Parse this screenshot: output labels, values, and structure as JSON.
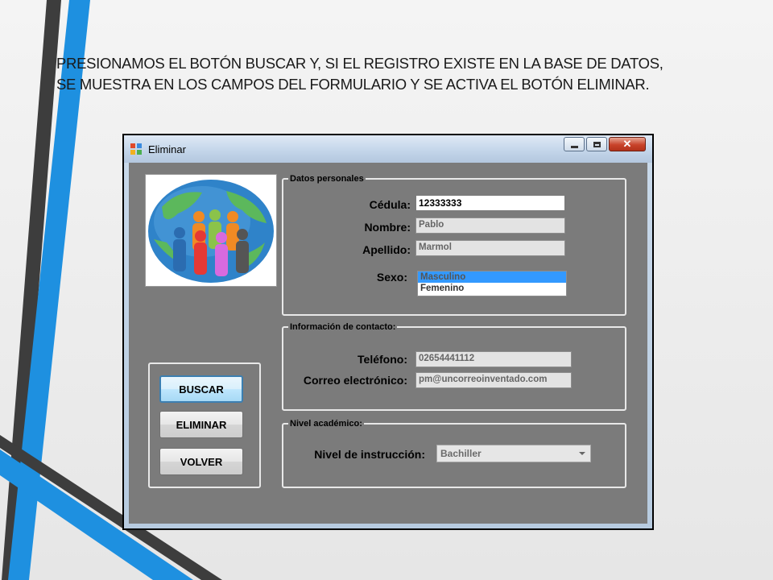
{
  "slide": {
    "line1": "PRESIONAMOS EL BOTÓN BUSCAR Y, SI EL REGISTRO EXISTE EN LA BASE DE DATOS,",
    "line2": "SE MUESTRA EN LOS CAMPOS DEL FORMULARIO Y SE ACTIVA EL BOTÓN ELIMINAR."
  },
  "colors": {
    "accent_blue": "#1e90e0",
    "dark_stripe": "#3d3d3d",
    "client_bg": "#7b7b7b",
    "selection": "#3399ff"
  },
  "window": {
    "title": "Eliminar",
    "controls": [
      "minimize-icon",
      "maximize-icon",
      "close-icon"
    ]
  },
  "datos_personales": {
    "legend": "Datos personales",
    "cedula_label": "Cédula:",
    "cedula_value": "12333333",
    "nombre_label": "Nombre:",
    "nombre_value": "Pablo",
    "apellido_label": "Apellido:",
    "apellido_value": "Marmol",
    "sexo_label": "Sexo:",
    "sexo_options": [
      "Masculino",
      "Femenino"
    ],
    "sexo_selected": "Masculino"
  },
  "contacto": {
    "legend": "Información de contacto:",
    "telefono_label": "Teléfono:",
    "telefono_value": "02654441112",
    "correo_label": "Correo electrónico:",
    "correo_value": "pm@uncorreoinventado.com"
  },
  "academico": {
    "legend": "Nivel académico:",
    "nivel_label": "Nivel de instrucción:",
    "nivel_value": "Bachiller"
  },
  "buttons": {
    "buscar": "BUSCAR",
    "eliminar": "ELIMINAR",
    "volver": "VOLVER"
  }
}
